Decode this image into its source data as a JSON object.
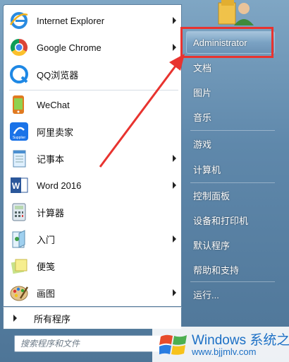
{
  "left_programs": [
    {
      "label": "Internet Explorer",
      "icon": "internet-explorer-icon",
      "has_submenu": true
    },
    {
      "label": "Google Chrome",
      "icon": "google-chrome-icon",
      "has_submenu": true
    },
    {
      "label": "QQ浏览器",
      "icon": "qq-browser-icon",
      "has_submenu": false
    },
    {
      "label": "WeChat",
      "icon": "wechat-icon",
      "has_submenu": false
    },
    {
      "label": "阿里卖家",
      "icon": "ali-seller-icon",
      "has_submenu": false
    },
    {
      "label": "记事本",
      "icon": "notepad-icon",
      "has_submenu": true
    },
    {
      "label": "Word 2016",
      "icon": "word-icon",
      "has_submenu": true
    },
    {
      "label": "计算器",
      "icon": "calculator-icon",
      "has_submenu": false
    },
    {
      "label": "入门",
      "icon": "getting-started-icon",
      "has_submenu": true
    },
    {
      "label": "便笺",
      "icon": "sticky-notes-icon",
      "has_submenu": false
    },
    {
      "label": "画图",
      "icon": "paint-icon",
      "has_submenu": true
    }
  ],
  "all_programs": {
    "label": "所有程序"
  },
  "search": {
    "placeholder": "搜索程序和文件"
  },
  "right_panel": {
    "user": "Administrator",
    "items": [
      "文档",
      "图片",
      "音乐",
      "游戏",
      "计算机",
      "控制面板",
      "设备和打印机",
      "默认程序",
      "帮助和支持",
      "运行..."
    ]
  },
  "watermark": {
    "title": "Windows 系统之家",
    "url": "www.bjjmlv.com"
  },
  "colors": {
    "annotation_red": "#e8332f",
    "panel_blue": "#5f88ab",
    "watermark_blue": "#1b6fc5"
  }
}
